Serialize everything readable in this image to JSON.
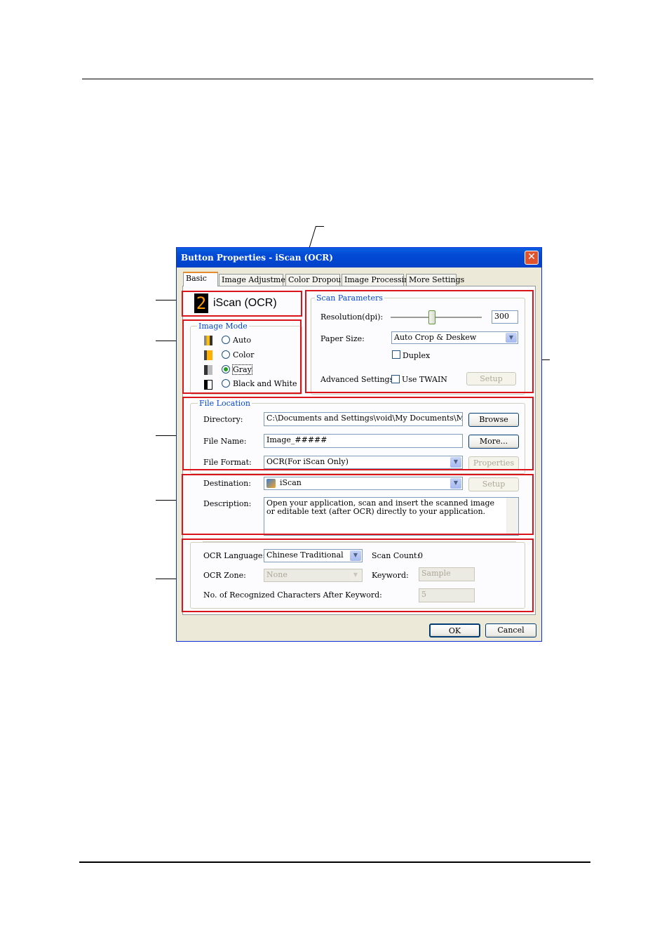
{
  "dialog": {
    "title": "Button Properties - iScan (OCR)",
    "close_glyph": "✕",
    "tabs": [
      "Basic",
      "Image Adjustment",
      "Color Dropout",
      "Image Processing",
      "More Settings"
    ],
    "button_number": "2",
    "button_name": "iScan (OCR)",
    "image_mode": {
      "label": "Image Mode",
      "options": [
        "Auto",
        "Color",
        "Gray",
        "Black and White"
      ],
      "selected": "Gray"
    },
    "scan_parameters": {
      "label": "Scan Parameters",
      "resolution_label": "Resolution(dpi):",
      "resolution_value": "300",
      "resolution_fraction": 0.45,
      "paper_size_label": "Paper Size:",
      "paper_size_value": "Auto Crop & Deskew",
      "duplex_label": "Duplex",
      "advanced_label": "Advanced Settings:",
      "twain_label": "Use TWAIN",
      "setup_label": "Setup"
    },
    "file_location": {
      "label": "File Location",
      "directory_label": "Directory:",
      "directory_value": "C:\\Documents and Settings\\void\\My Documents\\My Pictures",
      "browse_label": "Browse",
      "file_name_label": "File Name:",
      "file_name_value": "Image_#####",
      "more_label": "More...",
      "file_format_label": "File Format:",
      "file_format_value": "OCR(For iScan Only)",
      "properties_label": "Properties"
    },
    "destination": {
      "label": "Destination:",
      "value": "iScan",
      "setup_label": "Setup",
      "description_label": "Description:",
      "description_text": "Open your application, scan and insert the scanned image or editable text (after OCR) directly to your application."
    },
    "ocr": {
      "language_label": "OCR Language:",
      "language_value": "Chinese Traditional",
      "scan_count_label": "Scan Count:",
      "scan_count_value": "0",
      "zone_label": "OCR Zone:",
      "zone_value": "None",
      "keyword_label": "Keyword:",
      "keyword_value": "Sample",
      "chars_label": "No. of Recognized Characters After Keyword:",
      "chars_value": "5"
    },
    "ok_label": "OK",
    "cancel_label": "Cancel"
  }
}
